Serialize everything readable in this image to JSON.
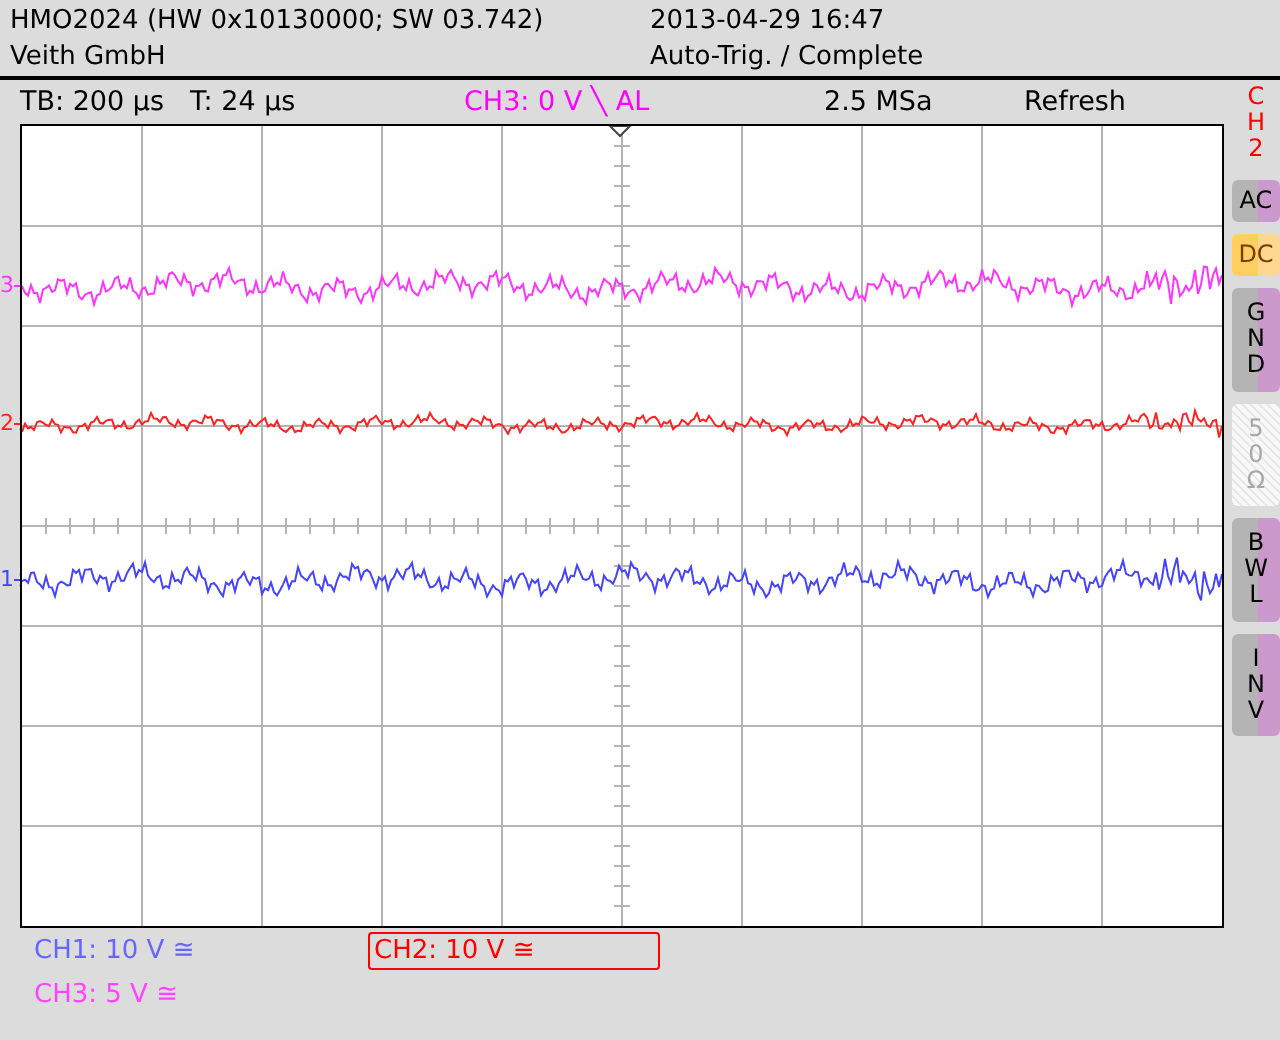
{
  "header": {
    "device": "HMO2024 (HW 0x10130000; SW 03.742)",
    "owner": "Veith GmbH",
    "datetime": "2013-04-29 16:47",
    "trigger_status": "Auto-Trig. / Complete"
  },
  "info_bar": {
    "timebase": "TB: 200 µs",
    "trigger_time": "T: 24 µs",
    "trigger_source": "CH3: 0 V ╲ AL",
    "sample_rate": "2.5 MSa",
    "mode": "Refresh"
  },
  "channel_markers": [
    {
      "label": "3",
      "color": "#ff33ff"
    },
    {
      "label": "2",
      "color": "#ff2222"
    },
    {
      "label": "1",
      "color": "#4444ff"
    }
  ],
  "side_panel": {
    "title": "CH2",
    "buttons": [
      {
        "label": "AC",
        "selected": false,
        "disabled": false
      },
      {
        "label": "DC",
        "selected": true,
        "disabled": false
      },
      {
        "label": "GND",
        "selected": false,
        "disabled": false
      },
      {
        "label": "50Ω",
        "selected": false,
        "disabled": true
      },
      {
        "label": "BWL",
        "selected": false,
        "disabled": false
      },
      {
        "label": "INV",
        "selected": false,
        "disabled": false
      }
    ]
  },
  "channels": [
    {
      "label": "CH1: 10 V ≅",
      "color": "#6666ff",
      "selected": false
    },
    {
      "label": "CH2: 10 V ≅",
      "color": "#ff0000",
      "selected": true
    },
    {
      "label": "CH3: 5 V ≅",
      "color": "#ff44ff",
      "selected": false
    }
  ]
}
